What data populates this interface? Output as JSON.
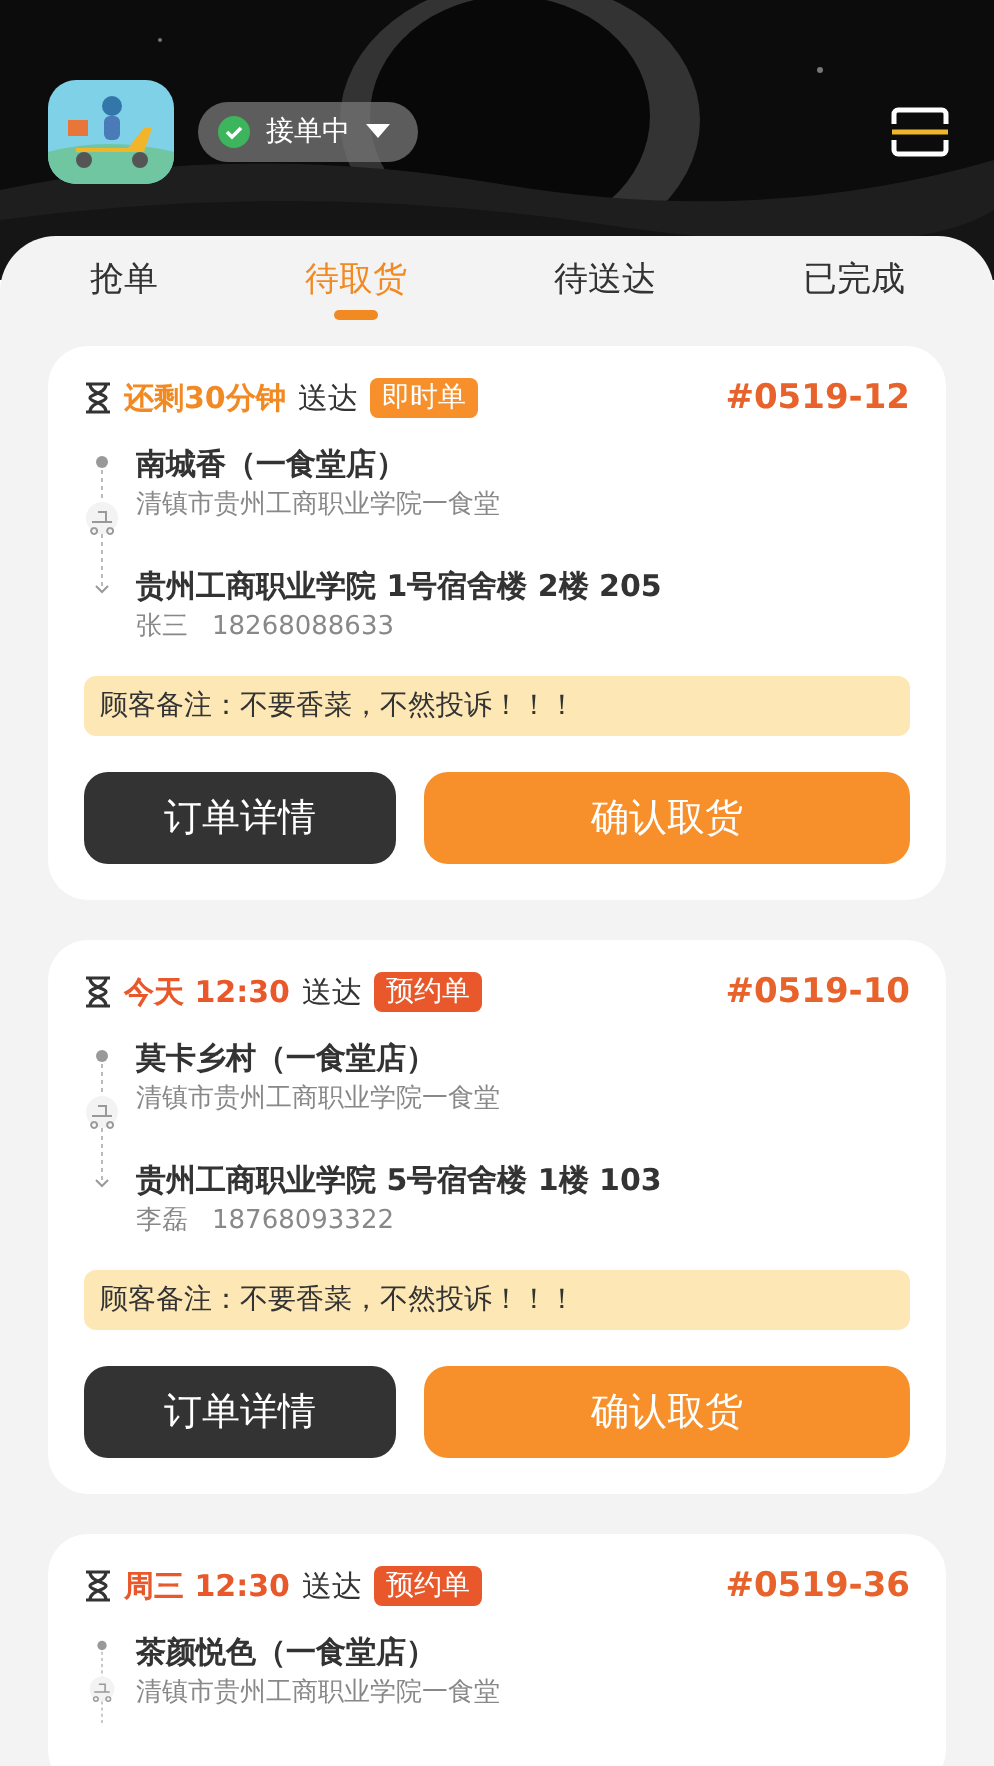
{
  "header": {
    "status": {
      "label": "接单中",
      "on": true
    }
  },
  "tabs": [
    {
      "label": "抢单",
      "selected": false
    },
    {
      "label": "待取货",
      "selected": true
    },
    {
      "label": "待送达",
      "selected": false
    },
    {
      "label": "已完成",
      "selected": false
    }
  ],
  "orders": [
    {
      "time": "还剩30分钟",
      "kind": "instant",
      "deliver": "送达",
      "tag": "即时单",
      "number": "#0519-12",
      "store": "南城香（一食堂店）",
      "store_address": "清镇市贵州工商职业学院一食堂",
      "destination": "贵州工商职业学院 1号宿舍楼 2楼 205",
      "customer": "张三",
      "phone": "18268088633",
      "note": "顾客备注：不要香菜，不然投诉！！！",
      "buttons": [
        "订单详情",
        "确认取货"
      ]
    },
    {
      "time": "今天 12:30",
      "kind": "reserved",
      "deliver": "送达",
      "tag": "预约单",
      "number": "#0519-10",
      "store": "莫卡乡村（一食堂店）",
      "store_address": "清镇市贵州工商职业学院一食堂",
      "destination": "贵州工商职业学院 5号宿舍楼 1楼 103",
      "customer": "李磊",
      "phone": "18768093322",
      "note": "顾客备注：不要香菜，不然投诉！！！",
      "buttons": [
        "订单详情",
        "确认取货"
      ]
    },
    {
      "time": "周三 12:30",
      "kind": "reserved",
      "deliver": "送达",
      "tag": "预约单",
      "number": "#0519-36",
      "store": "茶颜悦色（一食堂店）",
      "store_address": "清镇市贵州工商职业学院一食堂"
    }
  ]
}
